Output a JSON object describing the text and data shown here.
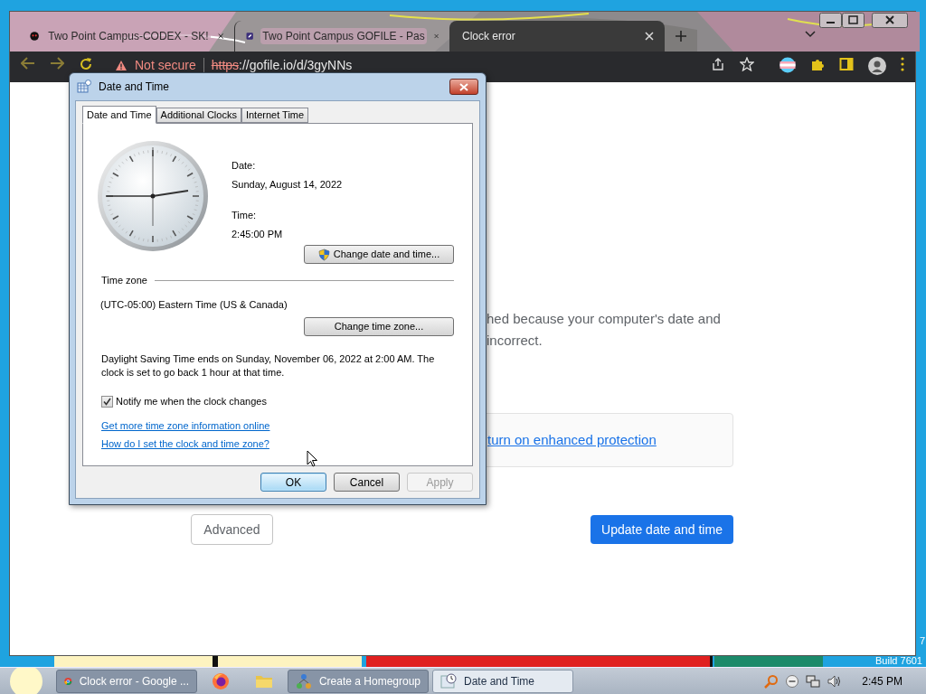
{
  "browser": {
    "tabs": [
      {
        "title": "Two Point Campus-CODEX - SK!",
        "kind": "site-dark",
        "selected": false
      },
      {
        "title": "Two Point Campus GOFILE - Pas",
        "kind": "site-edit",
        "selected": false
      },
      {
        "title": "Clock error",
        "kind": "none",
        "selected": true
      }
    ],
    "address": {
      "security": "Not secure",
      "scheme": "https",
      "rest": "://gofile.io/d/3gyNNs"
    }
  },
  "page": {
    "message_lines": [
      "hed because your computer's date and",
      "incorrect."
    ],
    "protection_link": "turn on enhanced protection",
    "advanced_button": "Advanced",
    "update_button": "Update date and time"
  },
  "dialog": {
    "title": "Date and Time",
    "tabs": [
      {
        "label": "Date and Time",
        "selected": true
      },
      {
        "label": "Additional Clocks",
        "selected": false
      },
      {
        "label": "Internet Time",
        "selected": false
      }
    ],
    "date_label": "Date:",
    "date": "Sunday, August 14, 2022",
    "time_label": "Time:",
    "time": "2:45:00 PM",
    "change_datetime_button": "Change date and time...",
    "timezone_heading": "Time zone",
    "timezone": "(UTC-05:00) Eastern Time (US & Canada)",
    "change_timezone_button": "Change time zone...",
    "dst_note": "Daylight Saving Time ends on Sunday, November 06, 2022 at 2:00 AM. The clock is set to go back 1 hour at that time.",
    "notify": {
      "label": "Notify me when the clock changes",
      "checked": true
    },
    "links": [
      "Get more time zone information online",
      "How do I set the clock and time zone?"
    ],
    "buttons": [
      {
        "label": "OK",
        "kind": "default",
        "disabled": false
      },
      {
        "label": "Cancel",
        "kind": "normal",
        "disabled": false
      },
      {
        "label": "Apply",
        "kind": "normal",
        "disabled": true
      }
    ]
  },
  "taskbar": {
    "items": [
      {
        "kind": "chrome",
        "label": "Clock error - Google ...",
        "selected": false
      },
      {
        "kind": "firefox",
        "selected": false
      },
      {
        "kind": "folder",
        "selected": false
      },
      {
        "kind": "network",
        "label": "Create a Homegroup",
        "selected": false
      },
      {
        "kind": "clock",
        "label": "Date and Time",
        "selected": true
      }
    ],
    "clock": "2:45 PM"
  },
  "desktop": {
    "corner_lines": [
      "7",
      "Build 7601"
    ]
  }
}
